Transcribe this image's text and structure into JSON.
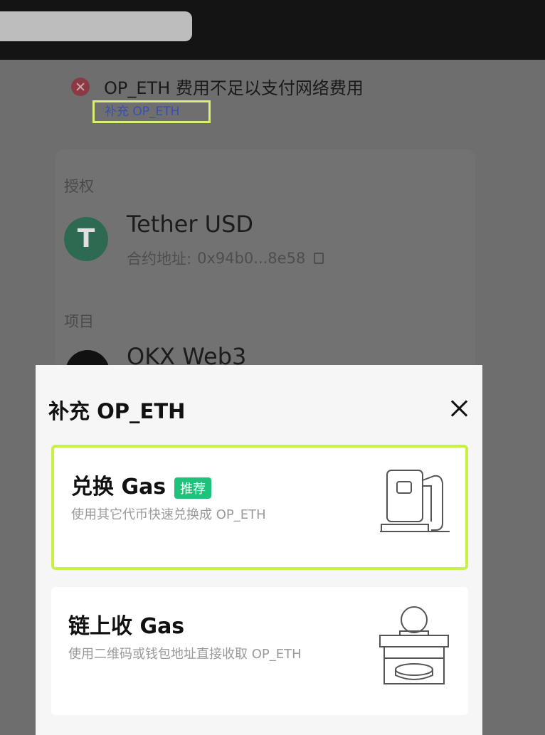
{
  "error": {
    "message": "OP_ETH 费用不足以支付网络费用",
    "link": "补充 OP_ETH"
  },
  "authorization": {
    "label": "授权",
    "token_name": "Tether USD",
    "token_symbol_glyph": "T",
    "address_label": "合约地址:",
    "address": "0x94b0...8e58"
  },
  "project": {
    "label": "项目",
    "name": "OKX Web3"
  },
  "sheet": {
    "title": "补充 OP_ETH",
    "options": [
      {
        "title": "兑换 Gas",
        "badge": "推荐",
        "desc": "使用其它代币快速兑换成 OP_ETH",
        "icon": "gas-pump-icon"
      },
      {
        "title": "链上收 Gas",
        "desc": "使用二维码或钱包地址直接收取 OP_ETH",
        "icon": "coin-deposit-icon"
      }
    ]
  },
  "colors": {
    "accent_border": "#c9f047",
    "badge": "#1ec27a",
    "link": "#3a4fb0"
  }
}
